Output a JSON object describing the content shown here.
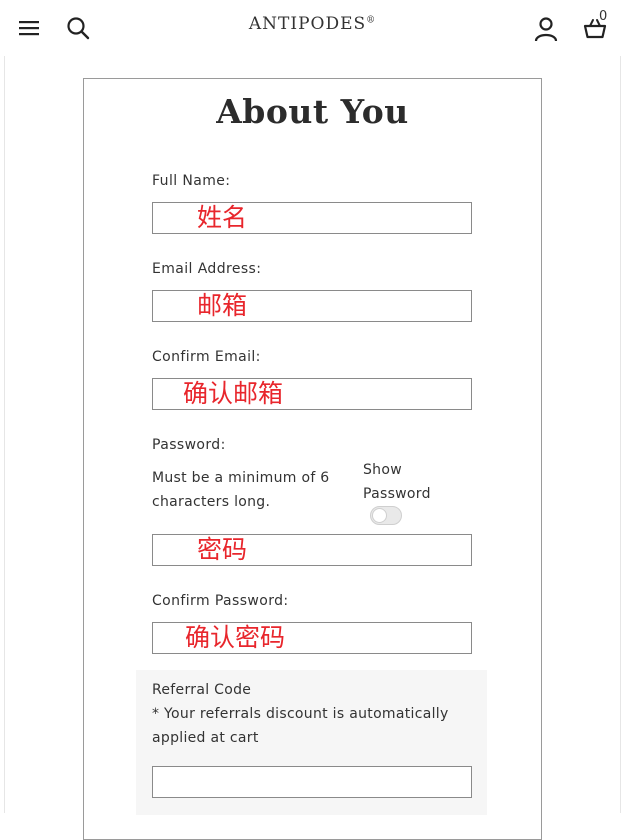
{
  "header": {
    "logo_text": "ANTIPODES",
    "logo_mark": "®",
    "basket_count": "0",
    "icons": {
      "menu": "hamburger-menu-icon",
      "search": "search-icon",
      "account": "account-icon",
      "basket": "basket-icon"
    }
  },
  "form": {
    "title": "About You",
    "full_name": {
      "label": "Full Name:",
      "value": "姓名"
    },
    "email": {
      "label": "Email Address:",
      "value": "邮箱"
    },
    "confirm_email": {
      "label": "Confirm Email:",
      "value": "确认邮箱"
    },
    "password": {
      "label": "Password:",
      "hint": "Must be a minimum of 6 characters long.",
      "show_label": "Show Password",
      "show_enabled": false,
      "value": "密码"
    },
    "confirm_password": {
      "label": "Confirm Password:",
      "value": "确认密码"
    },
    "referral": {
      "label": "Referral Code",
      "note": "* Your referrals discount is automatically applied at cart",
      "value": ""
    }
  },
  "colors": {
    "annotation_red": "#e8262c",
    "border": "#8a8a8a",
    "referral_bg": "#f6f6f6"
  }
}
